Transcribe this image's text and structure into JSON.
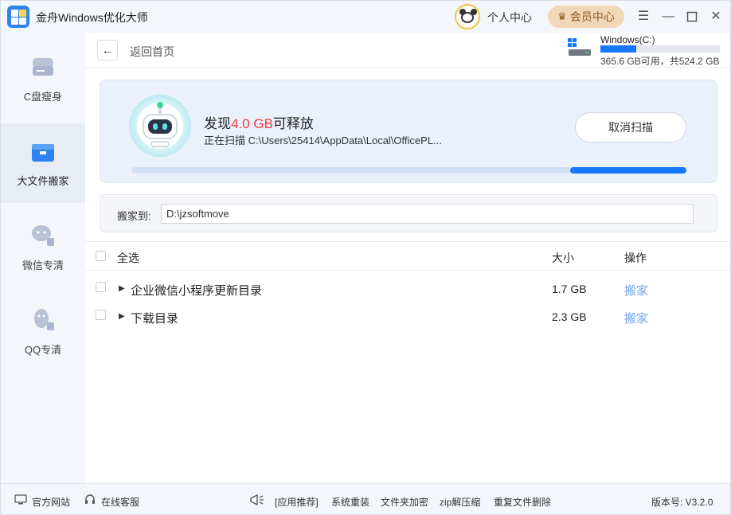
{
  "app": {
    "title": "金舟Windows优化大师"
  },
  "header": {
    "user_center": "个人中心",
    "vip_label": "会员中心",
    "window_controls": [
      "menu-icon",
      "minimize-icon",
      "maximize-icon",
      "close-icon"
    ]
  },
  "sidebar": {
    "items": [
      {
        "label": "C盘瘦身",
        "icon": "disk-icon",
        "active": false
      },
      {
        "label": "大文件搬家",
        "icon": "box-icon",
        "active": true
      },
      {
        "label": "微信专清",
        "icon": "wechat-clean-icon",
        "active": false
      },
      {
        "label": "QQ专清",
        "icon": "qq-clean-icon",
        "active": false
      }
    ]
  },
  "nav": {
    "back_label": "返回首页"
  },
  "drive": {
    "name": "Windows(C:)",
    "info": "365.6 GB可用，共524.2 GB",
    "used_fraction": 0.3
  },
  "scan": {
    "found_prefix": "发现",
    "found_size": "4.0 GB",
    "found_suffix": "可释放",
    "scanning_path": "正在扫描 C:\\Users\\25414\\AppData\\Local\\OfficePL...",
    "cancel_label": "取消扫描",
    "progress_segment": [
      0.79,
      1.0
    ],
    "highlight_color": "#f0383c"
  },
  "move": {
    "label": "搬家到:",
    "path": "D:\\jzsoftmove"
  },
  "table": {
    "select_all": "全选",
    "col_size": "大小",
    "col_action": "操作",
    "rows": [
      {
        "name": "企业微信小程序更新目录",
        "size": "1.7 GB",
        "action": "搬家"
      },
      {
        "name": "下载目录",
        "size": "2.3 GB",
        "action": "搬家"
      }
    ]
  },
  "footer": {
    "official_site": "官方网站",
    "online_service": "在线客服",
    "recommend": "[应用推荐]",
    "links": [
      "系统重装",
      "文件夹加密",
      "zip解压缩",
      "重复文件删除"
    ],
    "version": "版本号: V3.2.0"
  },
  "colors": {
    "accent": "#1677ff",
    "action_link": "#6fa6ea",
    "vip_bg": "#f2d8b6"
  }
}
